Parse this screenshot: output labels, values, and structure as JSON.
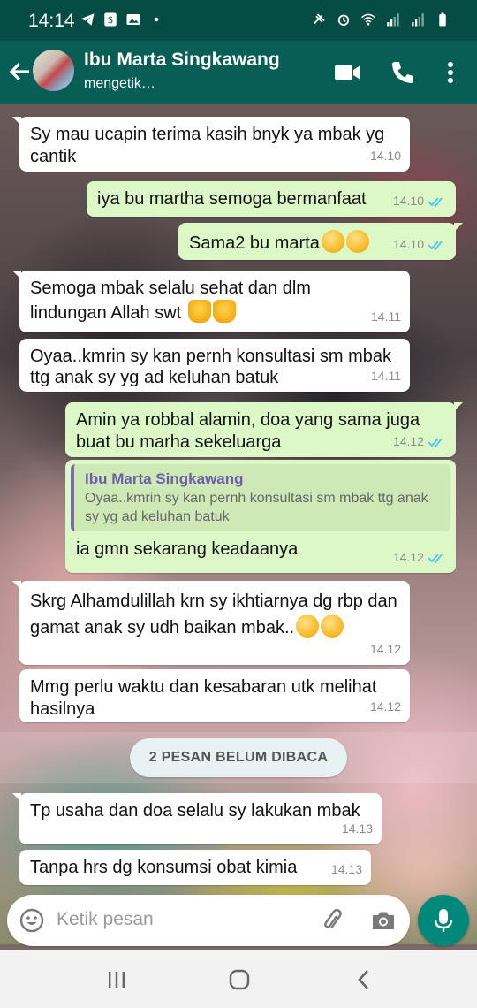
{
  "status_bar": {
    "time": "14:14",
    "left_icons": [
      "telegram-icon",
      "dollar-icon",
      "gallery-icon",
      "dot-icon"
    ],
    "right_icons": [
      "mute-icon",
      "alarm-icon",
      "wifi-icon",
      "signal-icon",
      "signal-icon",
      "battery-icon"
    ]
  },
  "header": {
    "contact_name": "Ibu Marta Singkawang",
    "contact_status": "mengetik…",
    "icons": [
      "back-arrow-icon",
      "video-call-icon",
      "phone-icon",
      "more-vert-icon"
    ],
    "bar_color": "#075e54"
  },
  "messages": [
    {
      "dir": "in",
      "text": "Sy mau ucapin terima kasih bnyk ya mbak yg cantik",
      "time": "14.10"
    },
    {
      "dir": "out",
      "text": "iya bu martha semoga bermanfaat",
      "time": "14.10"
    },
    {
      "dir": "out",
      "text": "Sama2 bu marta",
      "time": "14.10"
    },
    {
      "dir": "in",
      "text": "Semoga mbak selalu sehat dan dlm lindungan Allah swt",
      "time": "14.11"
    },
    {
      "dir": "in",
      "text": "Oyaa..kmrin sy kan pernh konsultasi sm mbak ttg anak sy yg ad keluhan batuk",
      "time": "14.11"
    },
    {
      "dir": "out",
      "text": "Amin ya robbal alamin, doa yang sama juga buat bu marha sekeluarga",
      "time": "14.12"
    },
    {
      "dir": "out",
      "quote_author": "Ibu Marta Singkawang",
      "quote_text": "Oyaa..kmrin sy kan pernh konsultasi sm mbak ttg anak sy yg ad keluhan batuk",
      "text": "ia gmn sekarang keadaanya",
      "time": "14.12"
    },
    {
      "dir": "in",
      "text": "Skrg Alhamdulillah krn sy ikhtiarnya dg rbp dan gamat anak sy udh baikan mbak..",
      "time": "14.12"
    },
    {
      "dir": "in",
      "text": "Mmg perlu waktu dan kesabaran utk melihat hasilnya",
      "time": "14.12"
    },
    {
      "dir": "in",
      "text": "Tp usaha dan doa selalu sy lakukan mbak",
      "time": "14.13"
    },
    {
      "dir": "in",
      "text": "Tanpa hrs dg konsumsi obat kimia",
      "time": "14.13"
    }
  ],
  "unread_banner": "2 PESAN BELUM DIBACA",
  "input": {
    "placeholder": "Ketik pesan",
    "icons": [
      "emoji-icon",
      "attach-icon",
      "camera-icon",
      "mic-icon"
    ]
  },
  "nav_bar": {
    "icons": [
      "recents-icon",
      "home-icon",
      "back-icon"
    ]
  },
  "colors": {
    "incoming_bubble": "#ffffff",
    "outgoing_bubble": "#dcf8c6",
    "read_ticks": "#4fc3f7",
    "accent": "#00897b"
  }
}
